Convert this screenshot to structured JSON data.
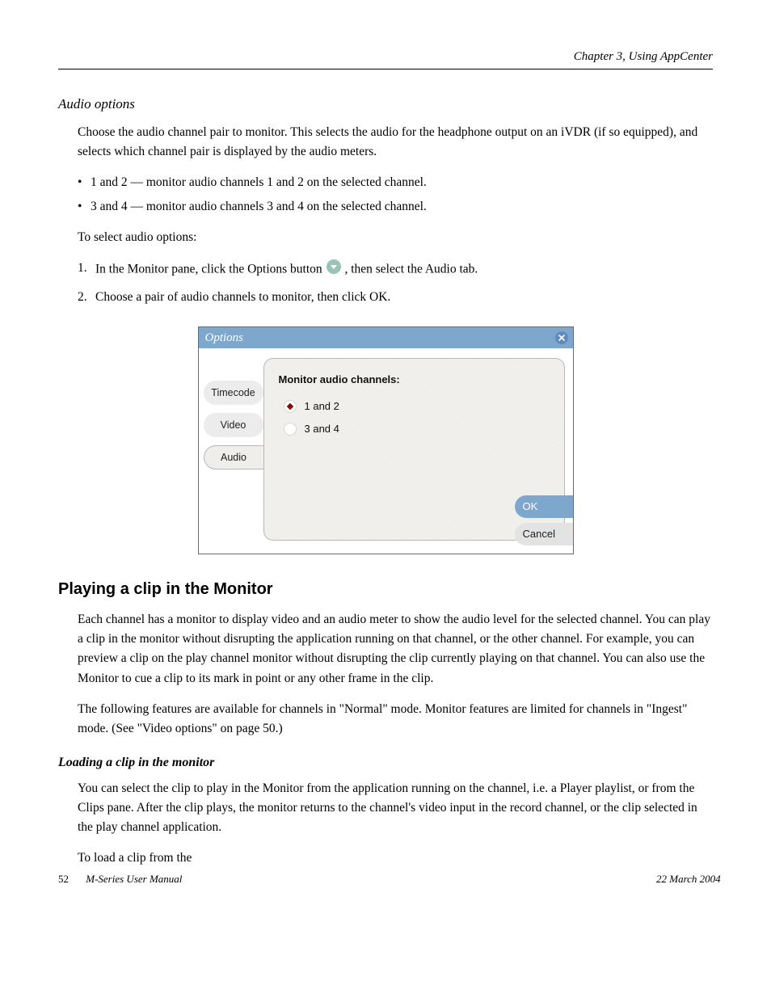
{
  "header": {
    "right": "Chapter 3, Using AppCenter"
  },
  "intro_title": "Audio options",
  "intro_para": "Choose the audio channel pair to monitor. This selects the audio for the headphone output on an iVDR (if so equipped), and selects which channel pair is displayed by the audio meters.",
  "bullets": {
    "b1": "1 and 2 — monitor audio channels 1 and 2 on the selected channel.",
    "b2": "3 and 4 — monitor audio channels 3 and 4 on the selected channel."
  },
  "steps": {
    "s1_lead": "In the Monitor pane, click the Options button ",
    "s1_tail": ", then select the Audio tab.",
    "s2": "Choose a pair of audio channels to monitor, then click OK."
  },
  "dialog": {
    "title": "Options",
    "tabs": {
      "t1": "Timecode",
      "t2": "Video",
      "t3": "Audio"
    },
    "panel_label": "Monitor audio channels:",
    "radios": {
      "r1": "1 and 2",
      "r2": "3 and 4"
    },
    "ok": "OK",
    "cancel": "Cancel"
  },
  "section2": {
    "title": "Playing a clip in the Monitor",
    "p1": "Each channel has a monitor to display video and an audio meter to show the audio level for the selected channel. You can play a clip in the monitor without disrupting the application running on that channel, or the other channel. For example, you can preview a clip on the play channel monitor without disrupting the clip currently playing on that channel. You can also use the Monitor to cue a clip to its mark in point or any other frame in the clip.",
    "p2": "The following features are available for channels in \"Normal\" mode. Monitor features are limited for channels in \"Ingest\" mode. (See \"Video options\" on page 50.)",
    "sub": "Loading a clip in the monitor",
    "p3": "You can select the clip to play in the Monitor from the application running on the channel, i.e. a Player playlist, or from the Clips pane. After the clip plays, the monitor returns to the channel's video input in the record channel, or the clip selected in the play channel application.",
    "from_lead": "To load a clip from the "
  },
  "footer": {
    "page": "52",
    "text": "M-Series User Manual",
    "date": "22 March 2004"
  }
}
